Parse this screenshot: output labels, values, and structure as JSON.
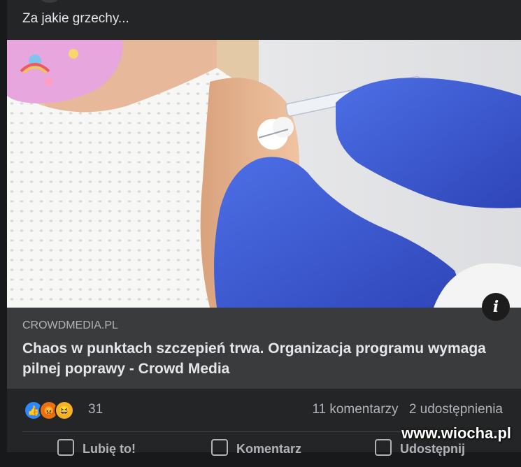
{
  "post": {
    "text": "Za jakie grzechy..."
  },
  "link": {
    "domain": "CROWDMEDIA.PL",
    "title": "Chaos w punktach szczepień trwa. Organizacja programu wymaga pilnej poprawy - Crowd Media",
    "info_icon": "i"
  },
  "reactions": {
    "icons": [
      "like-icon",
      "angry-icon",
      "haha-icon"
    ],
    "count": "31",
    "comments": "11 komentarzy",
    "shares": "2 udostępnienia"
  },
  "actions": {
    "like": "Lubię to!",
    "comment": "Komentarz",
    "share": "Udostępnij"
  },
  "watermark": "www.wiocha.pl",
  "colors": {
    "background": "#18191a",
    "card": "#242526",
    "link_meta": "#3a3b3c",
    "glove": "#3f5fd8",
    "like": "#2d88ff",
    "angry": "#e9710f",
    "haha": "#f7b125"
  }
}
